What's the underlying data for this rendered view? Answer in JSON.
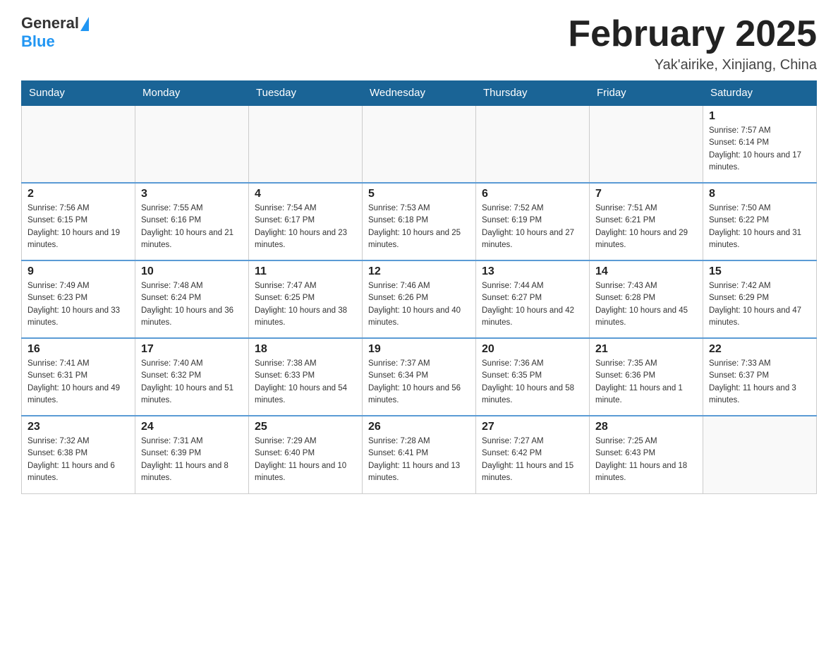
{
  "logo": {
    "general": "General",
    "blue": "Blue"
  },
  "header": {
    "month_year": "February 2025",
    "location": "Yak'airike, Xinjiang, China"
  },
  "weekdays": [
    "Sunday",
    "Monday",
    "Tuesday",
    "Wednesday",
    "Thursday",
    "Friday",
    "Saturday"
  ],
  "weeks": [
    [
      {
        "day": "",
        "info": ""
      },
      {
        "day": "",
        "info": ""
      },
      {
        "day": "",
        "info": ""
      },
      {
        "day": "",
        "info": ""
      },
      {
        "day": "",
        "info": ""
      },
      {
        "day": "",
        "info": ""
      },
      {
        "day": "1",
        "info": "Sunrise: 7:57 AM\nSunset: 6:14 PM\nDaylight: 10 hours and 17 minutes."
      }
    ],
    [
      {
        "day": "2",
        "info": "Sunrise: 7:56 AM\nSunset: 6:15 PM\nDaylight: 10 hours and 19 minutes."
      },
      {
        "day": "3",
        "info": "Sunrise: 7:55 AM\nSunset: 6:16 PM\nDaylight: 10 hours and 21 minutes."
      },
      {
        "day": "4",
        "info": "Sunrise: 7:54 AM\nSunset: 6:17 PM\nDaylight: 10 hours and 23 minutes."
      },
      {
        "day": "5",
        "info": "Sunrise: 7:53 AM\nSunset: 6:18 PM\nDaylight: 10 hours and 25 minutes."
      },
      {
        "day": "6",
        "info": "Sunrise: 7:52 AM\nSunset: 6:19 PM\nDaylight: 10 hours and 27 minutes."
      },
      {
        "day": "7",
        "info": "Sunrise: 7:51 AM\nSunset: 6:21 PM\nDaylight: 10 hours and 29 minutes."
      },
      {
        "day": "8",
        "info": "Sunrise: 7:50 AM\nSunset: 6:22 PM\nDaylight: 10 hours and 31 minutes."
      }
    ],
    [
      {
        "day": "9",
        "info": "Sunrise: 7:49 AM\nSunset: 6:23 PM\nDaylight: 10 hours and 33 minutes."
      },
      {
        "day": "10",
        "info": "Sunrise: 7:48 AM\nSunset: 6:24 PM\nDaylight: 10 hours and 36 minutes."
      },
      {
        "day": "11",
        "info": "Sunrise: 7:47 AM\nSunset: 6:25 PM\nDaylight: 10 hours and 38 minutes."
      },
      {
        "day": "12",
        "info": "Sunrise: 7:46 AM\nSunset: 6:26 PM\nDaylight: 10 hours and 40 minutes."
      },
      {
        "day": "13",
        "info": "Sunrise: 7:44 AM\nSunset: 6:27 PM\nDaylight: 10 hours and 42 minutes."
      },
      {
        "day": "14",
        "info": "Sunrise: 7:43 AM\nSunset: 6:28 PM\nDaylight: 10 hours and 45 minutes."
      },
      {
        "day": "15",
        "info": "Sunrise: 7:42 AM\nSunset: 6:29 PM\nDaylight: 10 hours and 47 minutes."
      }
    ],
    [
      {
        "day": "16",
        "info": "Sunrise: 7:41 AM\nSunset: 6:31 PM\nDaylight: 10 hours and 49 minutes."
      },
      {
        "day": "17",
        "info": "Sunrise: 7:40 AM\nSunset: 6:32 PM\nDaylight: 10 hours and 51 minutes."
      },
      {
        "day": "18",
        "info": "Sunrise: 7:38 AM\nSunset: 6:33 PM\nDaylight: 10 hours and 54 minutes."
      },
      {
        "day": "19",
        "info": "Sunrise: 7:37 AM\nSunset: 6:34 PM\nDaylight: 10 hours and 56 minutes."
      },
      {
        "day": "20",
        "info": "Sunrise: 7:36 AM\nSunset: 6:35 PM\nDaylight: 10 hours and 58 minutes."
      },
      {
        "day": "21",
        "info": "Sunrise: 7:35 AM\nSunset: 6:36 PM\nDaylight: 11 hours and 1 minute."
      },
      {
        "day": "22",
        "info": "Sunrise: 7:33 AM\nSunset: 6:37 PM\nDaylight: 11 hours and 3 minutes."
      }
    ],
    [
      {
        "day": "23",
        "info": "Sunrise: 7:32 AM\nSunset: 6:38 PM\nDaylight: 11 hours and 6 minutes."
      },
      {
        "day": "24",
        "info": "Sunrise: 7:31 AM\nSunset: 6:39 PM\nDaylight: 11 hours and 8 minutes."
      },
      {
        "day": "25",
        "info": "Sunrise: 7:29 AM\nSunset: 6:40 PM\nDaylight: 11 hours and 10 minutes."
      },
      {
        "day": "26",
        "info": "Sunrise: 7:28 AM\nSunset: 6:41 PM\nDaylight: 11 hours and 13 minutes."
      },
      {
        "day": "27",
        "info": "Sunrise: 7:27 AM\nSunset: 6:42 PM\nDaylight: 11 hours and 15 minutes."
      },
      {
        "day": "28",
        "info": "Sunrise: 7:25 AM\nSunset: 6:43 PM\nDaylight: 11 hours and 18 minutes."
      },
      {
        "day": "",
        "info": ""
      }
    ]
  ]
}
